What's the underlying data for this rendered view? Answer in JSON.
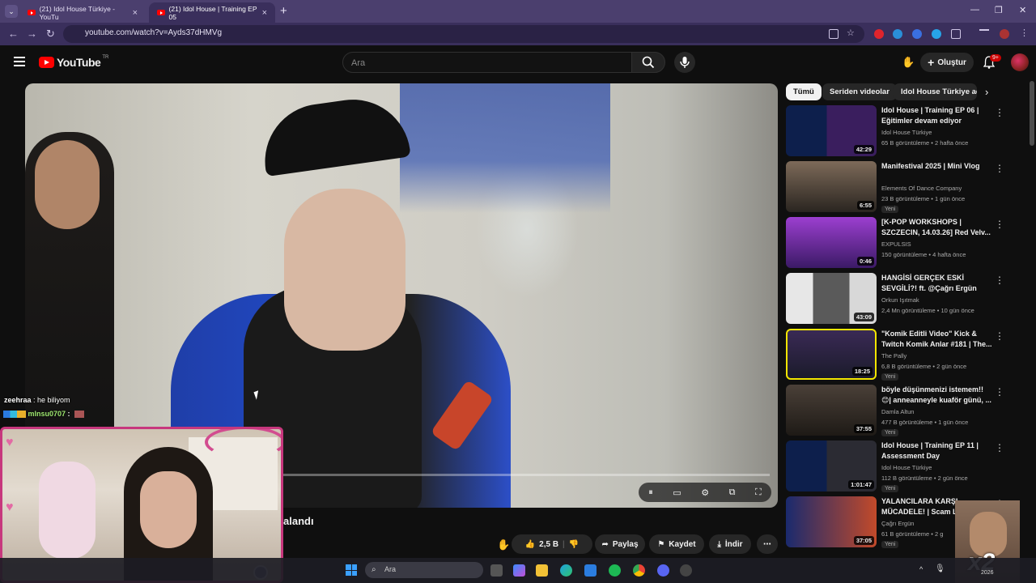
{
  "browser": {
    "tabs": [
      {
        "label": "(21) Idol House Türkiye - YouTu"
      },
      {
        "label": "(21) Idol House | Training EP 05"
      }
    ],
    "url": "youtube.com/watch?v=Ayds37dHMVg"
  },
  "youtube": {
    "logo_text": "YouTube",
    "country_code": "TR",
    "search_placeholder": "Ara",
    "create_label": "Oluştur",
    "notification_count": "9+"
  },
  "player": {
    "progress_fraction": 0.0
  },
  "chat": [
    {
      "user": "zeehraa",
      "text": " : he biliyom"
    },
    {
      "user": "mlnsu0707",
      "text": " :"
    }
  ],
  "video": {
    "title_fragment": "alandı",
    "like_count": "2,5 B",
    "share_label": "Paylaş",
    "save_label": "Kaydet",
    "download_label": "İndir"
  },
  "chips": [
    {
      "label": "Tümü"
    },
    {
      "label": "Seriden videolar"
    },
    {
      "label": "Idol House Türkiye ad"
    }
  ],
  "recommendations": [
    {
      "title": "Idol House | Training EP 06 | Eğitimler devam ediyor",
      "channel": "Idol House Türkiye",
      "meta": "65 B görüntüleme • 2 hafta önce",
      "duration": "42:29",
      "badge": ""
    },
    {
      "title": "Manifestival 2025 | Mini Vlog",
      "channel": "Elements Of Dance Company",
      "meta": "23 B görüntüleme • 1 gün önce",
      "duration": "6:55",
      "badge": "Yeni"
    },
    {
      "title": "[K-POP WORKSHOPS | SZCZECIN, 14.03.26] Red Velv...",
      "channel": "EXPULSIS",
      "meta": "150 görüntüleme • 4 hafta önce",
      "duration": "0:46",
      "badge": ""
    },
    {
      "title": "HANGİSİ GERÇEK ESKİ SEVGİLİ?! ft. @Çağrı Ergün",
      "channel": "Orkun Işıtmak",
      "meta": "2,4 Mn görüntüleme • 10 gün önce",
      "duration": "43:09",
      "badge": ""
    },
    {
      "title": "\"Komik Editli Video\" Kick & Twitch Komik Anlar #181 | The...",
      "channel": "The Pally",
      "meta": "6,8 B görüntüleme • 2 gün önce",
      "duration": "18:25",
      "badge": "Yeni"
    },
    {
      "title": "böyle düşünmenizi istemem!! 😊| anneanneyle kuaför günü, ...",
      "channel": "Damla Altun",
      "meta": "477 B görüntüleme • 1 gün önce",
      "duration": "37:55",
      "badge": "Yeni"
    },
    {
      "title": "Idol House | Training EP 11 | Assessment Day",
      "channel": "Idol House Türkiye",
      "meta": "112 B görüntüleme • 2 gün önce",
      "duration": "1:01:47",
      "badge": "Yeni"
    },
    {
      "title": "YALANCILARA KARŞI MÜCADELE! | Scam L",
      "channel": "Çağrı Ergün",
      "meta": "61 B görüntüleme • 2 g",
      "duration": "37:05",
      "badge": "Yeni"
    }
  ],
  "taskbar": {
    "search_label": "Ara",
    "clock": "2026"
  },
  "meme_text": "x2"
}
